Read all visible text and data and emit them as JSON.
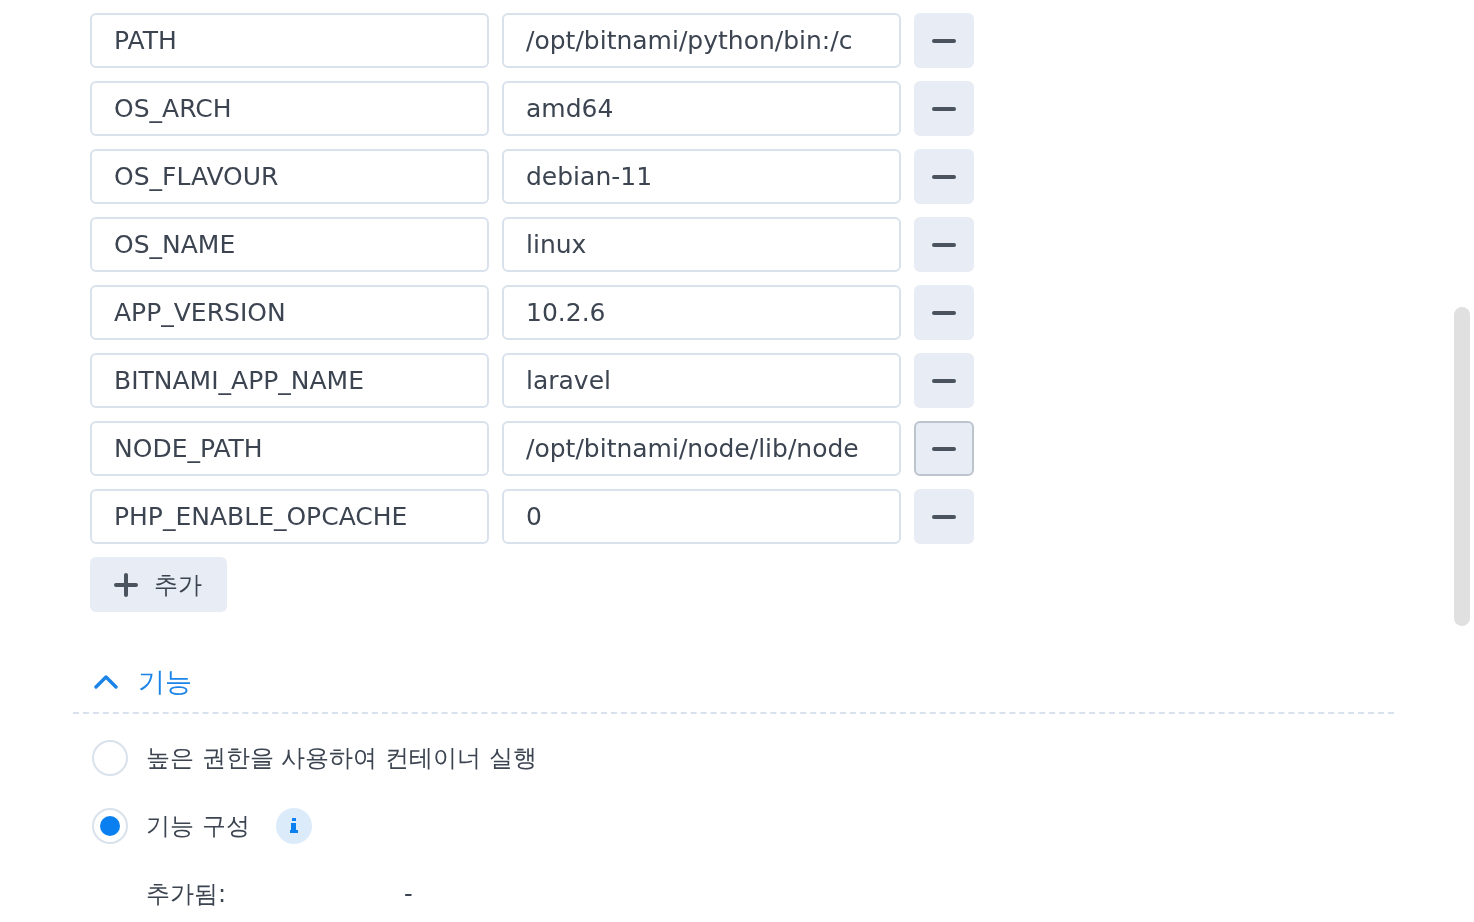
{
  "env_vars": {
    "rows": [
      {
        "name": "PATH",
        "value": "/opt/bitnami/python/bin:/c",
        "remove_hovered": false
      },
      {
        "name": "OS_ARCH",
        "value": "amd64",
        "remove_hovered": false
      },
      {
        "name": "OS_FLAVOUR",
        "value": "debian-11",
        "remove_hovered": false
      },
      {
        "name": "OS_NAME",
        "value": "linux",
        "remove_hovered": false
      },
      {
        "name": "APP_VERSION",
        "value": "10.2.6",
        "remove_hovered": false
      },
      {
        "name": "BITNAMI_APP_NAME",
        "value": "laravel",
        "remove_hovered": false
      },
      {
        "name": "NODE_PATH",
        "value": "/opt/bitnami/node/lib/node",
        "remove_hovered": true
      },
      {
        "name": "PHP_ENABLE_OPCACHE",
        "value": "0",
        "remove_hovered": false
      }
    ],
    "add_button": {
      "label": "추가"
    }
  },
  "section": {
    "title": "기능",
    "expanded": true,
    "options": [
      {
        "label": "높은 권한을 사용하여 컨테이너 실행",
        "selected": false,
        "info": false
      },
      {
        "label": "기능 구성",
        "selected": true,
        "info": true
      }
    ],
    "details": [
      {
        "label": "추가됨:",
        "value": "-"
      }
    ]
  }
}
